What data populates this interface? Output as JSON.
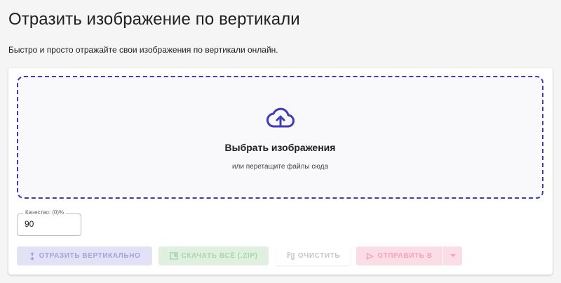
{
  "header": {
    "title": "Отразить изображение по вертикали",
    "subtitle": "Быстро и просто отражайте свои изображения по вертикали онлайн."
  },
  "dropzone": {
    "icon": "cloud-upload-icon",
    "title": "Выбрать изображения",
    "hint": "или перетащите файлы сюда"
  },
  "quality": {
    "label": "Качество: (0)%",
    "value": "90"
  },
  "actions": {
    "flip_label": "Отразить вертикально",
    "zip_label": "Скачать всё (.zip)",
    "clear_label": "Очистить",
    "send_label": "Отправить в"
  },
  "colors": {
    "accent": "#3f3db5",
    "flip_button": "#e2e1f6",
    "zip_button": "#dff0e0",
    "send_button": "#fbdde6"
  }
}
